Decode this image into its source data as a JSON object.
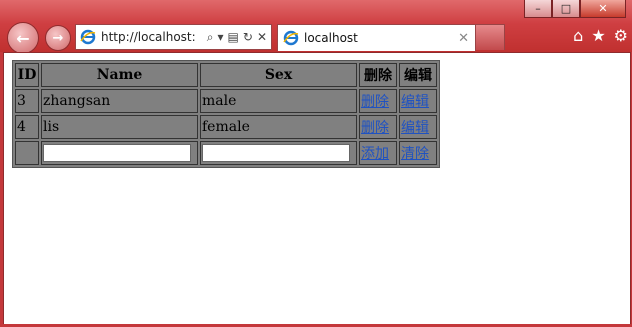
{
  "browser": {
    "address_url": "http://localhost:",
    "tab_title": "localhost",
    "window_buttons": [
      "–",
      "□",
      "✕"
    ]
  },
  "table": {
    "headers": [
      "ID",
      "Name",
      "Sex",
      "删除",
      "编辑"
    ],
    "rows": [
      {
        "id": "3",
        "name": "zhangsan",
        "sex": "male",
        "delete": "删除",
        "edit": "编辑"
      },
      {
        "id": "4",
        "name": "lis",
        "sex": "female",
        "delete": "删除",
        "edit": "编辑"
      }
    ],
    "new_row": {
      "name_value": "",
      "sex_value": "",
      "add": "添加",
      "clear": "清除"
    }
  },
  "colors": {
    "chrome": "#cf3f42",
    "cell_bg": "#808080",
    "link": "#1f52c2"
  }
}
